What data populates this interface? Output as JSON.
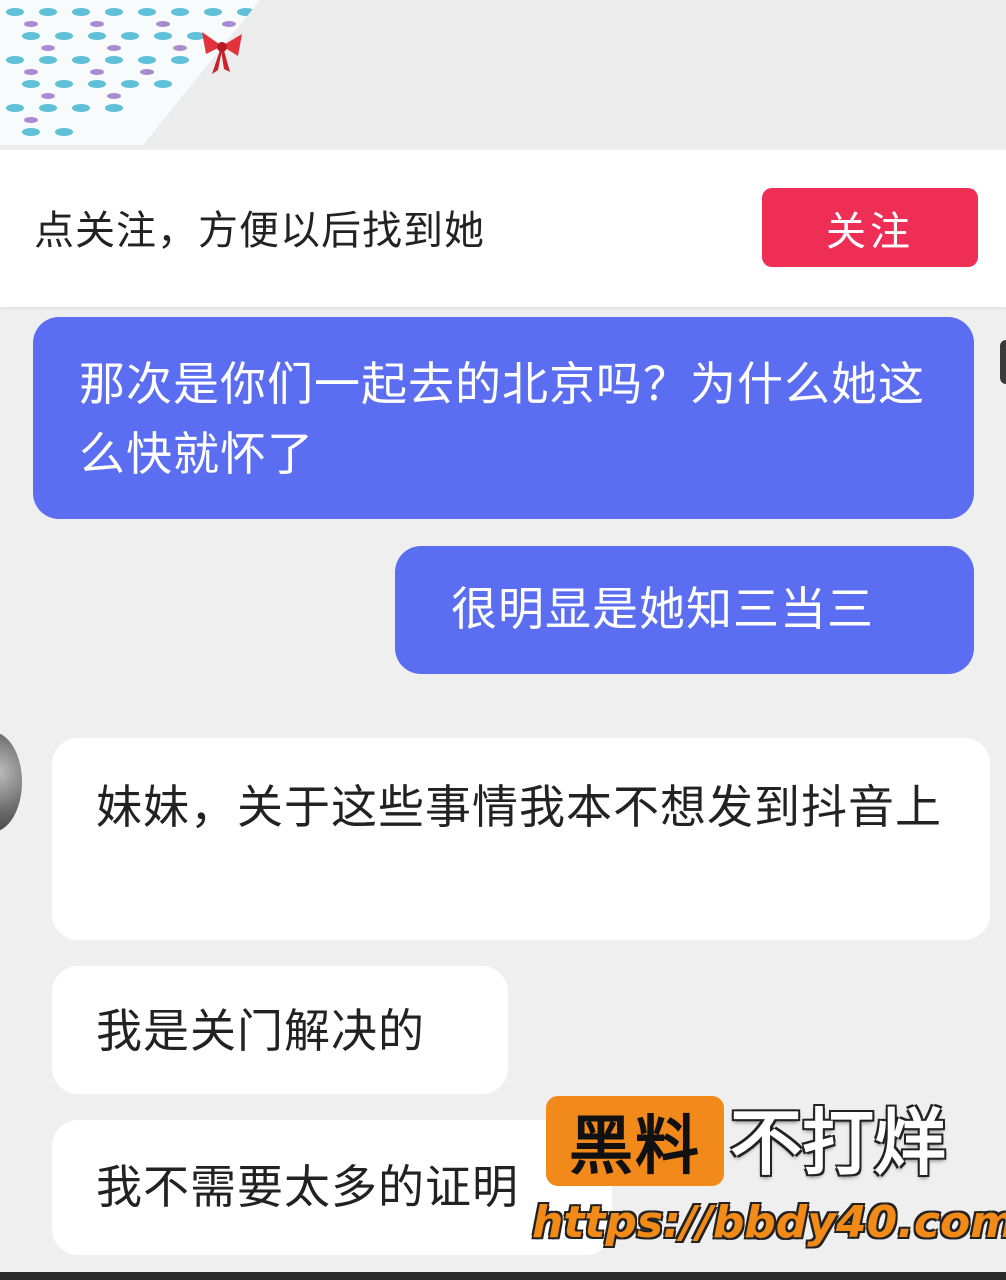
{
  "follow_banner": {
    "prompt_text": "点关注，方便以后找到她",
    "follow_button_label": "关注"
  },
  "messages": [
    {
      "direction": "sent",
      "text": "那次是你们一起去的北京吗？为什么她这么快就怀了"
    },
    {
      "direction": "sent",
      "text": "很明显是她知三当三"
    },
    {
      "direction": "received",
      "text": "妹妹，关于这些事情我本不想发到抖音上"
    },
    {
      "direction": "received",
      "text": "我是关门解决的"
    },
    {
      "direction": "received",
      "text": "我不需要太多的证明"
    }
  ],
  "watermark": {
    "badge_text": "黑料",
    "slogan": "不打烊",
    "url": "https://bbdy40.com"
  },
  "colors": {
    "sent_bubble": "#5b6df0",
    "received_bubble": "#ffffff",
    "follow_button": "#ee2e55",
    "watermark_orange": "#f2891b"
  },
  "icons": [
    "bow-icon",
    "avatar"
  ]
}
